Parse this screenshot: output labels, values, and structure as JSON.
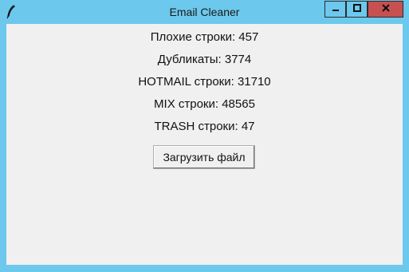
{
  "window": {
    "title": "Email Cleaner",
    "controls": {
      "minimize_icon": "minimize-icon",
      "maximize_icon": "maximize-icon",
      "close_icon": "close-icon"
    },
    "app_icon": "feather-icon",
    "colors": {
      "titlebar": "#6cc8ec",
      "close_button": "#c75050",
      "client_background": "#f0f0f0"
    }
  },
  "stats": {
    "bad_lines": "Плохие строки: 457",
    "duplicates": "Дубликаты: 3774",
    "hotmail_lines": "HOTMAIL строки: 31710",
    "mix_lines": "MIX строки: 48565",
    "trash_lines": "TRASH строки: 47"
  },
  "actions": {
    "load_file_label": "Загрузить файл"
  }
}
